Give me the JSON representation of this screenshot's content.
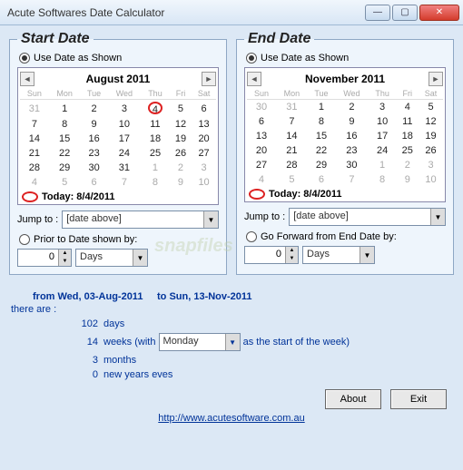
{
  "window": {
    "title": "Acute Softwares Date Calculator"
  },
  "start": {
    "legend": "Start Date",
    "radio_shown": "Use Date as Shown",
    "radio_prior": "Prior to Date shown by:",
    "month": "August 2011",
    "today_label": "Today: 8/4/2011",
    "jump_label": "Jump to :",
    "jump_value": "[date above]",
    "offset": "0",
    "unit": "Days",
    "weekdays": [
      "Sun",
      "Mon",
      "Tue",
      "Wed",
      "Thu",
      "Fri",
      "Sat"
    ],
    "weeks": [
      [
        {
          "d": "31",
          "o": 1
        },
        {
          "d": "1"
        },
        {
          "d": "2"
        },
        {
          "d": "3"
        },
        {
          "d": "4",
          "m": 1
        },
        {
          "d": "5"
        },
        {
          "d": "6"
        }
      ],
      [
        {
          "d": "7"
        },
        {
          "d": "8"
        },
        {
          "d": "9"
        },
        {
          "d": "10"
        },
        {
          "d": "11"
        },
        {
          "d": "12"
        },
        {
          "d": "13"
        }
      ],
      [
        {
          "d": "14"
        },
        {
          "d": "15"
        },
        {
          "d": "16"
        },
        {
          "d": "17"
        },
        {
          "d": "18"
        },
        {
          "d": "19"
        },
        {
          "d": "20"
        }
      ],
      [
        {
          "d": "21"
        },
        {
          "d": "22"
        },
        {
          "d": "23"
        },
        {
          "d": "24"
        },
        {
          "d": "25"
        },
        {
          "d": "26"
        },
        {
          "d": "27"
        }
      ],
      [
        {
          "d": "28"
        },
        {
          "d": "29"
        },
        {
          "d": "30"
        },
        {
          "d": "31"
        },
        {
          "d": "1",
          "o": 1
        },
        {
          "d": "2",
          "o": 1
        },
        {
          "d": "3",
          "o": 1
        }
      ],
      [
        {
          "d": "4",
          "o": 1
        },
        {
          "d": "5",
          "o": 1
        },
        {
          "d": "6",
          "o": 1
        },
        {
          "d": "7",
          "o": 1
        },
        {
          "d": "8",
          "o": 1
        },
        {
          "d": "9",
          "o": 1
        },
        {
          "d": "10",
          "o": 1
        }
      ]
    ]
  },
  "end": {
    "legend": "End Date",
    "radio_shown": "Use Date as Shown",
    "radio_forward": "Go Forward from End Date by:",
    "month": "November 2011",
    "today_label": "Today: 8/4/2011",
    "jump_label": "Jump to :",
    "jump_value": "[date above]",
    "offset": "0",
    "unit": "Days",
    "weekdays": [
      "Sun",
      "Mon",
      "Tue",
      "Wed",
      "Thu",
      "Fri",
      "Sat"
    ],
    "weeks": [
      [
        {
          "d": "30",
          "o": 1
        },
        {
          "d": "31",
          "o": 1
        },
        {
          "d": "1"
        },
        {
          "d": "2"
        },
        {
          "d": "3"
        },
        {
          "d": "4"
        },
        {
          "d": "5"
        }
      ],
      [
        {
          "d": "6"
        },
        {
          "d": "7"
        },
        {
          "d": "8"
        },
        {
          "d": "9"
        },
        {
          "d": "10"
        },
        {
          "d": "11"
        },
        {
          "d": "12"
        }
      ],
      [
        {
          "d": "13"
        },
        {
          "d": "14"
        },
        {
          "d": "15"
        },
        {
          "d": "16"
        },
        {
          "d": "17"
        },
        {
          "d": "18"
        },
        {
          "d": "19"
        }
      ],
      [
        {
          "d": "20"
        },
        {
          "d": "21"
        },
        {
          "d": "22"
        },
        {
          "d": "23"
        },
        {
          "d": "24"
        },
        {
          "d": "25"
        },
        {
          "d": "26"
        }
      ],
      [
        {
          "d": "27"
        },
        {
          "d": "28"
        },
        {
          "d": "29"
        },
        {
          "d": "30"
        },
        {
          "d": "1",
          "o": 1
        },
        {
          "d": "2",
          "o": 1
        },
        {
          "d": "3",
          "o": 1
        }
      ],
      [
        {
          "d": "4",
          "o": 1
        },
        {
          "d": "5",
          "o": 1
        },
        {
          "d": "6",
          "o": 1
        },
        {
          "d": "7",
          "o": 1
        },
        {
          "d": "8",
          "o": 1
        },
        {
          "d": "9",
          "o": 1
        },
        {
          "d": "10",
          "o": 1
        }
      ]
    ]
  },
  "summary": {
    "from": "from Wed, 03-Aug-2011",
    "to": "to Sun, 13-Nov-2011",
    "there": "there are :",
    "days_n": "102",
    "days_u": "days",
    "weeks_n": "14",
    "weeks_pre": "weeks (with",
    "weeks_post": "as the start of the week)",
    "week_start": "Monday",
    "months_n": "3",
    "months_u": "months",
    "ny_n": "0",
    "ny_u": "new years eves"
  },
  "buttons": {
    "about": "About",
    "exit": "Exit"
  },
  "link": "http://www.acutesoftware.com.au"
}
